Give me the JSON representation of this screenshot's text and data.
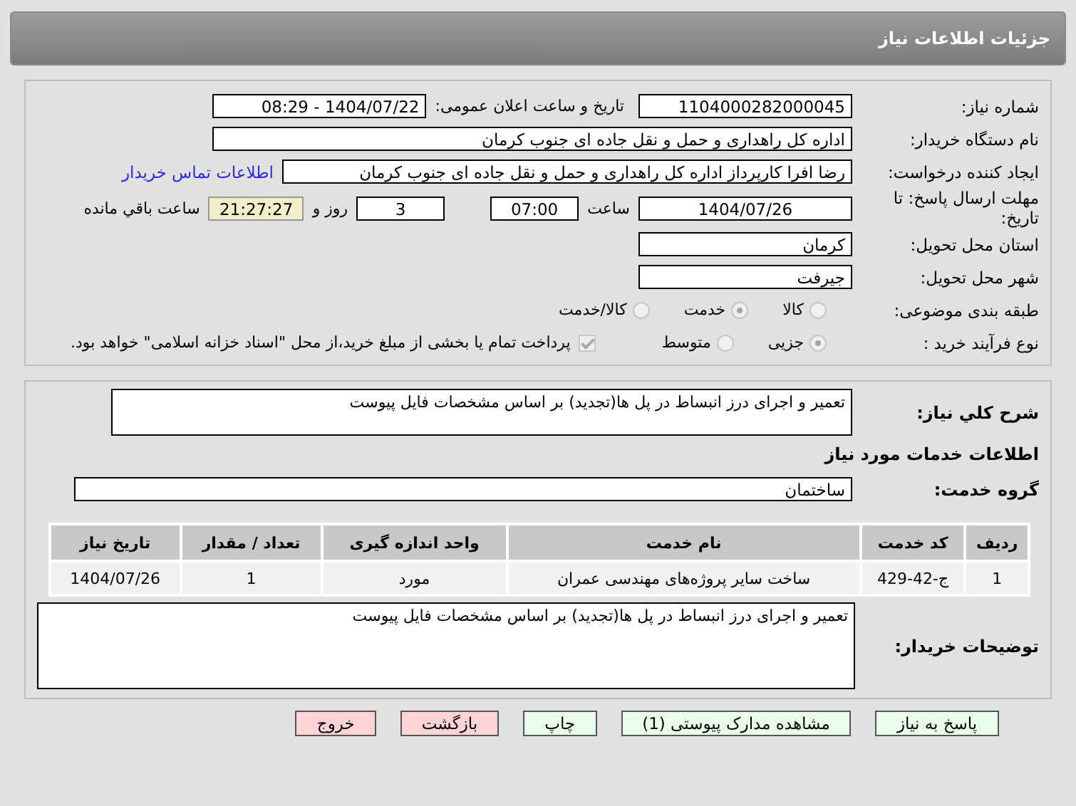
{
  "header": {
    "title": "جزئیات اطلاعات نیاز"
  },
  "need_number": {
    "label": "شماره نیاز:",
    "value": "1104000282000045"
  },
  "announce": {
    "label": "تاریخ و ساعت اعلان عمومی:",
    "value": "1404/07/22 - 08:29"
  },
  "buyer_org": {
    "label": "نام دستگاه خریدار:",
    "value": "اداره کل راهداری و حمل و نقل جاده ای جنوب کرمان"
  },
  "requester": {
    "label": "ایجاد کننده درخواست:",
    "value": "رضا افرا کارپرداز اداره کل راهداری و حمل و نقل جاده ای جنوب کرمان",
    "link": "اطلاعات تماس خریدار"
  },
  "deadline": {
    "label": "مهلت ارسال پاسخ: تا تاریخ:",
    "date": "1404/07/26",
    "time_label": "ساعت",
    "time": "07:00",
    "days": "3",
    "days_label": "روز و",
    "remaining": "21:27:27",
    "remaining_label": "ساعت باقي مانده"
  },
  "province": {
    "label": "استان محل تحویل:",
    "value": "کرمان"
  },
  "city": {
    "label": "شهر محل تحویل:",
    "value": "جیرفت"
  },
  "category": {
    "label": "طبقه بندی موضوعی:",
    "options": [
      {
        "label": "کالا",
        "selected": false
      },
      {
        "label": "خدمت",
        "selected": true
      },
      {
        "label": "کالا/خدمت",
        "selected": false
      }
    ]
  },
  "process": {
    "label": "نوع فرآیند خرید :",
    "options": [
      {
        "label": "جزیی",
        "selected": true
      },
      {
        "label": "متوسط",
        "selected": false
      }
    ],
    "checkbox": {
      "label": "پرداخت تمام یا بخشی از مبلغ خرید،از محل \"اسناد خزانه اسلامی\" خواهد بود.",
      "checked": true
    }
  },
  "description": {
    "label": "شرح کلي نیاز:",
    "value": "تعمیر و اجرای درز انبساط در پل ها(تجدید) بر اساس مشخصات فایل پیوست"
  },
  "services_heading": "اطلاعات خدمات مورد نیاز",
  "service_group": {
    "label": "گروه خدمت:",
    "value": "ساختمان"
  },
  "table": {
    "columns": [
      "ردیف",
      "کد خدمت",
      "نام خدمت",
      "واحد اندازه گیری",
      "تعداد / مقدار",
      "تاریخ نیاز"
    ],
    "rows": [
      [
        "1",
        "ج-42-429",
        "ساخت سایر پروژه‌های مهندسی عمران",
        "مورد",
        "1",
        "1404/07/26"
      ]
    ]
  },
  "buyer_notes": {
    "label": "توضیحات خریدار:",
    "value": "تعمیر و اجرای درز انبساط در پل ها(تجدید) بر اساس مشخصات فایل پیوست"
  },
  "buttons": [
    {
      "label": "پاسخ به نیاز",
      "kind": "primary"
    },
    {
      "label": "مشاهده مدارک پیوستی (1)",
      "kind": "primary"
    },
    {
      "label": "چاپ",
      "kind": "primary"
    },
    {
      "label": "بازگشت",
      "kind": "danger"
    },
    {
      "label": "خروج",
      "kind": "danger"
    }
  ]
}
